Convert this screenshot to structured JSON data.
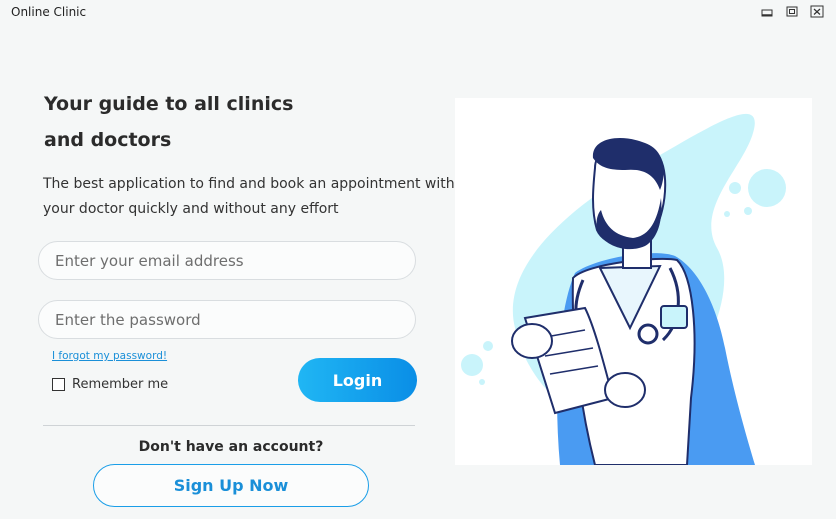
{
  "window": {
    "title": "Online Clinic",
    "controls": [
      "minimize-icon",
      "restore-icon",
      "close-icon"
    ]
  },
  "main": {
    "heading_line1": "Your guide to all clinics",
    "heading_line2": "and doctors",
    "subtitle_line1": "The best application to find and book an appointment with",
    "subtitle_line2": "your doctor quickly and without any effort"
  },
  "form": {
    "email_placeholder": "Enter your email address",
    "email_value": "",
    "password_placeholder": "Enter the password",
    "password_value": "",
    "forgot_label": "I forgot my password!",
    "remember_label": "Remember me",
    "remember_checked": false,
    "login_label": "Login"
  },
  "signup": {
    "prompt": "Don't have an account?",
    "button_label": "Sign Up Now"
  },
  "colors": {
    "accent": "#1a9ee8",
    "illustration_light": "#c9f4fb",
    "illustration_blue": "#4a9bf2",
    "illustration_navy": "#1f2e6b"
  },
  "illustration": {
    "icon": "doctor-illustration-icon"
  }
}
